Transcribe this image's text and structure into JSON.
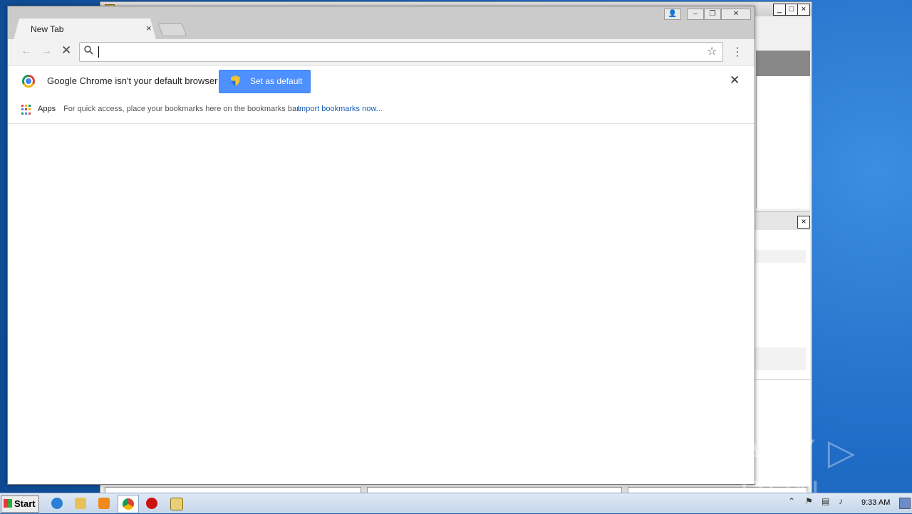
{
  "background_window": {
    "close_symbol": "×"
  },
  "chrome": {
    "tab": {
      "title": "New Tab",
      "close_symbol": "×"
    },
    "window_controls": {
      "profile": "👤",
      "minimize": "–",
      "restore": "❐",
      "close": "✕"
    },
    "toolbar": {
      "back_symbol": "←",
      "forward_symbol": "→",
      "stop_symbol": "✕",
      "search_symbol": "⌕",
      "omnibox_value": "",
      "bookmark_star": "☆",
      "menu_symbol": "⋮"
    },
    "infobar": {
      "message": "Google Chrome isn't your default browser",
      "button_label": "Set as default",
      "close_symbol": "✕"
    },
    "bookmarks_bar": {
      "apps_label": "Apps",
      "hint": "For quick access, place your bookmarks here on the bookmarks bar.",
      "import_link": "Import bookmarks now..."
    }
  },
  "watermark": "ANY ▷ RUN",
  "taskbar": {
    "start_label": "Start",
    "tray_arrow": "⌃",
    "clock": "9:33 AM"
  },
  "colors": {
    "accent_button": "#4d90fe",
    "link": "#1a5fb4"
  }
}
